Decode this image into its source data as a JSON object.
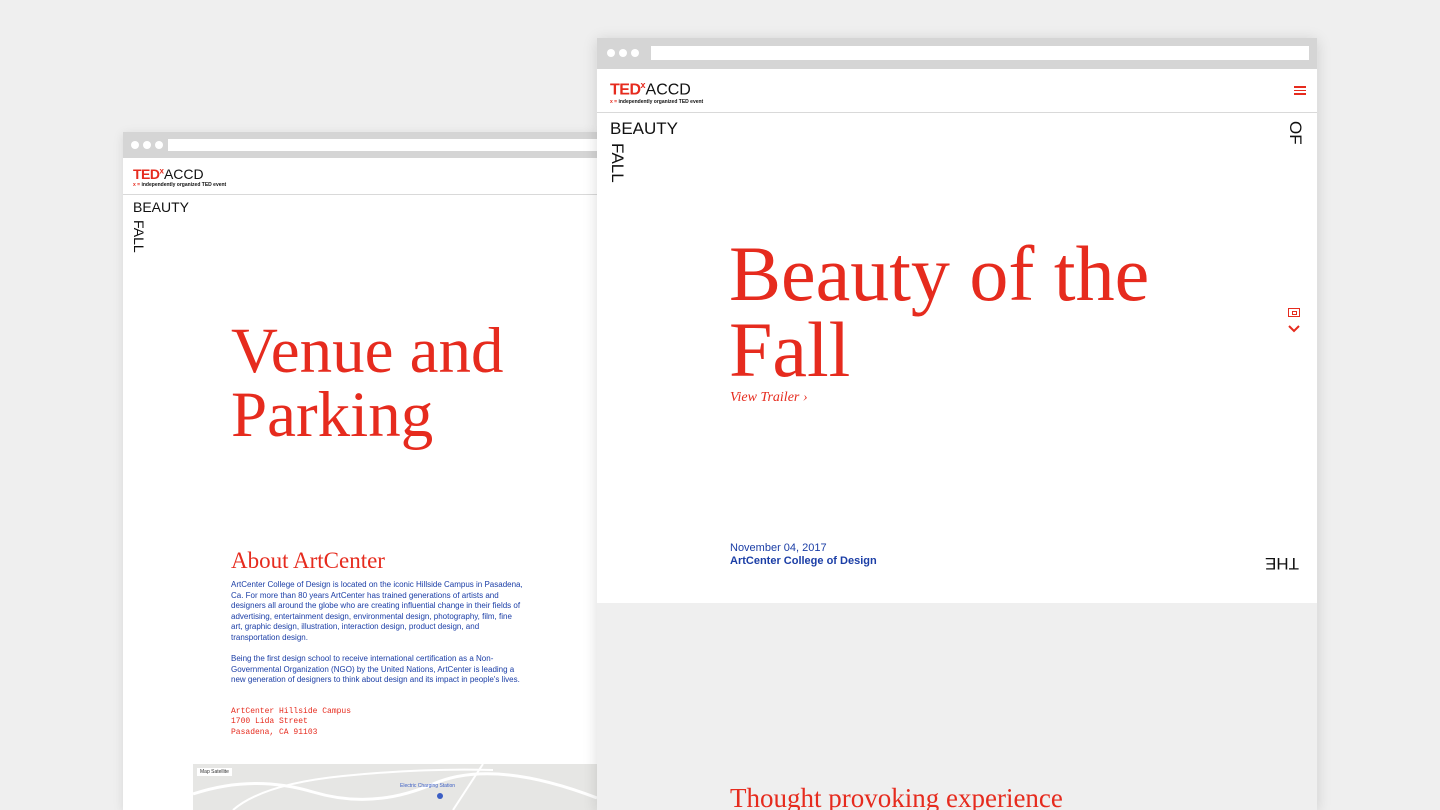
{
  "brand": {
    "ted": "TED",
    "x": "x",
    "accd": "ACCD",
    "tag_prefix": "x =",
    "tagline": "independently organized TED event",
    "red": "#e62b1e",
    "blue": "#1b3ea6"
  },
  "left_page": {
    "side_beauty": "BEAUTY",
    "side_fall": "FALL",
    "title": "Venue and Parking",
    "about_heading": "About ArtCenter",
    "paragraph_1": "ArtCenter College of Design is located on the iconic Hillside Campus in Pasadena, Ca. For more than 80 years ArtCenter has trained generations of artists and designers all around the globe who are creating influential change in their fields of advertising, entertainment design, environmental design, photography, film, fine art, graphic design, illustration, interaction design, product design, and transportation design.",
    "paragraph_2": "Being the first design school to receive international certification as a Non-Governmental Organization (NGO) by the United Nations, ArtCenter is leading a new generation of designers to think about design and its impact in people's lives.",
    "address_line_1": "ArtCenter Hillside Campus",
    "address_line_2": "1700 Lida Street",
    "address_line_3": "Pasadena, CA 91103",
    "map_tabs": "Map  Satellite",
    "map_label": "Electric Charging Station"
  },
  "right_page": {
    "side_beauty": "BEAUTY",
    "side_of": "OF",
    "side_the": "THE",
    "side_fall": "FALL",
    "title": "Beauty of the Fall",
    "trailer_link": "View Trailer ›",
    "date": "November 04, 2017",
    "venue": "ArtCenter College of Design",
    "section_heading": "Thought provoking experience",
    "icons": [
      "menu-icon",
      "ticket-icon",
      "chevron-down-icon"
    ]
  }
}
